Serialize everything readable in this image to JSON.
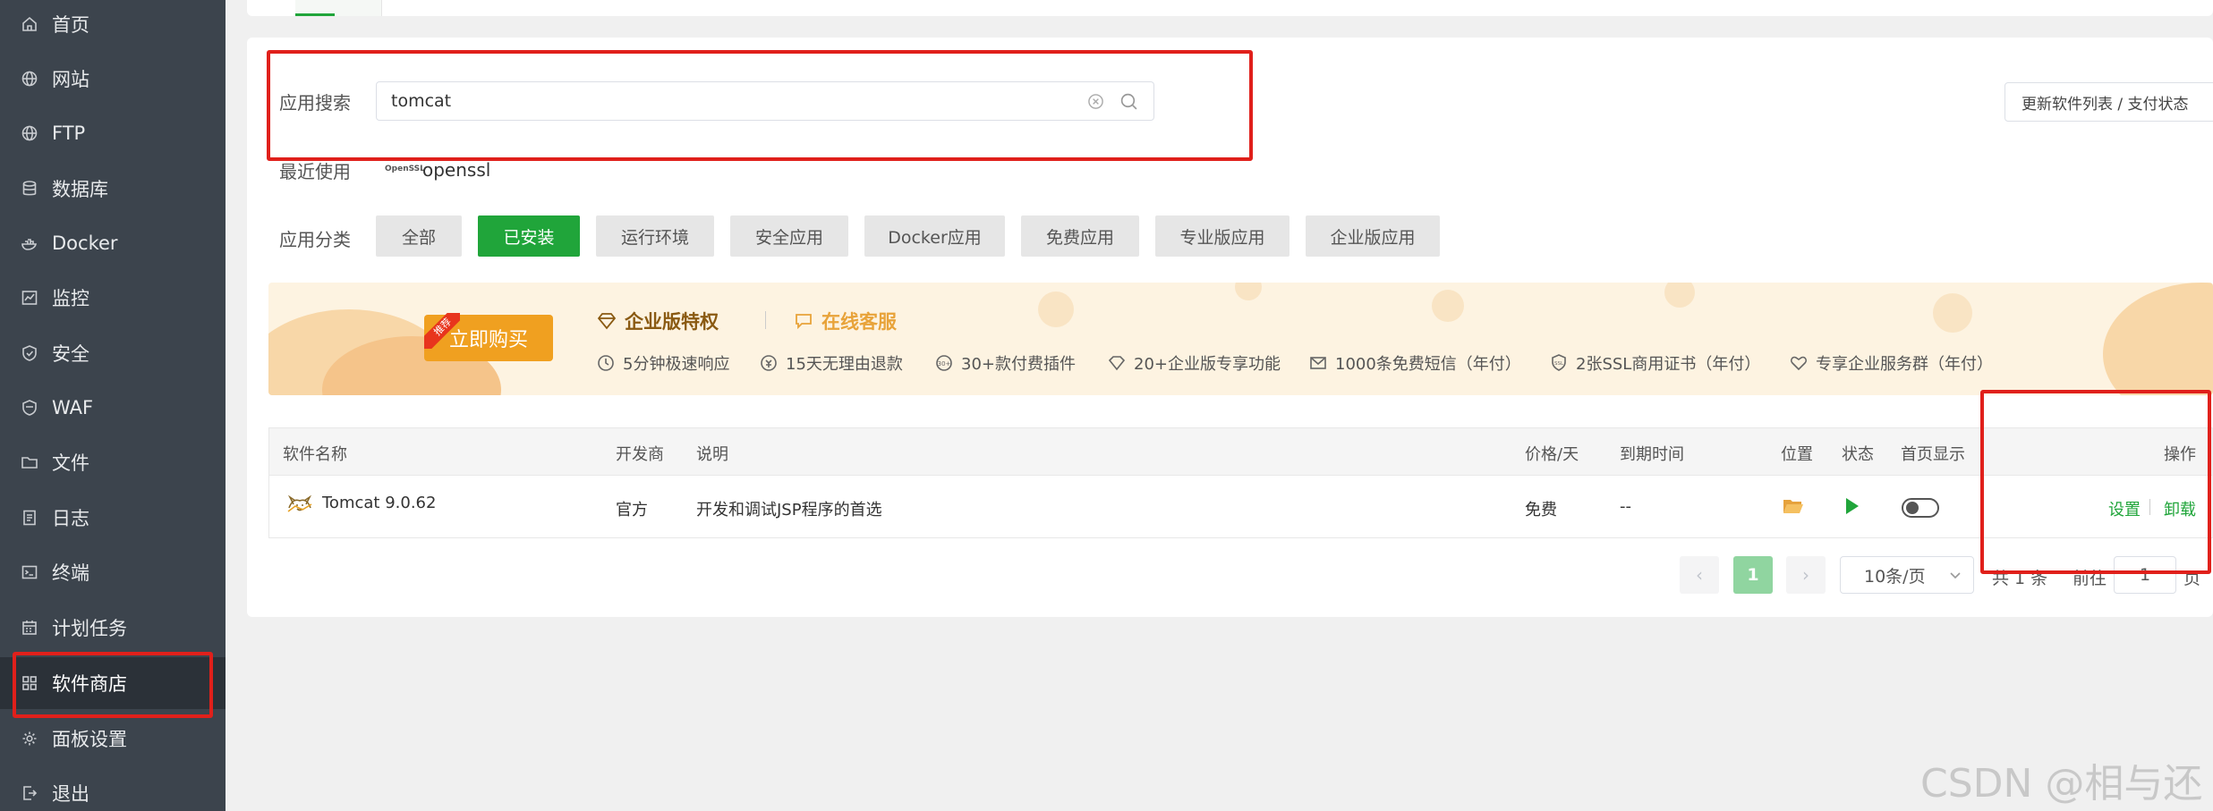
{
  "sidebar": {
    "items": [
      {
        "label": "首页",
        "icon": "home-icon"
      },
      {
        "label": "网站",
        "icon": "globe-icon"
      },
      {
        "label": "FTP",
        "icon": "globe-icon"
      },
      {
        "label": "数据库",
        "icon": "database-icon"
      },
      {
        "label": "Docker",
        "icon": "docker-icon"
      },
      {
        "label": "监控",
        "icon": "chart-icon"
      },
      {
        "label": "安全",
        "icon": "shield-icon"
      },
      {
        "label": "WAF",
        "icon": "waf-shield-icon"
      },
      {
        "label": "文件",
        "icon": "folder-icon"
      },
      {
        "label": "日志",
        "icon": "log-icon"
      },
      {
        "label": "终端",
        "icon": "terminal-icon"
      },
      {
        "label": "计划任务",
        "icon": "calendar-icon"
      },
      {
        "label": "软件商店",
        "icon": "grid-icon"
      },
      {
        "label": "面板设置",
        "icon": "gear-icon"
      },
      {
        "label": "退出",
        "icon": "logout-icon"
      }
    ],
    "active_index": 12
  },
  "search": {
    "label": "应用搜索",
    "value": "tomcat"
  },
  "refresh_button": "更新软件列表 / 支付状态",
  "recent": {
    "label": "最近使用",
    "logo_text": "OpenSSL",
    "item": "openssl"
  },
  "categories": {
    "label": "应用分类",
    "items": [
      "全部",
      "已安装",
      "运行环境",
      "安全应用",
      "Docker应用",
      "免费应用",
      "专业版应用",
      "企业版应用"
    ],
    "active_index": 1
  },
  "banner": {
    "ribbon": "推荐",
    "buy_button": "立即购买",
    "enterprise_title": "企业版特权",
    "service_title": "在线客服",
    "features": [
      "5分钟极速响应",
      "15天无理由退款",
      "30+款付费插件",
      "20+企业版专享功能",
      "1000条免费短信（年付）",
      "2张SSL商用证书（年付）",
      "专享企业服务群（年付）"
    ],
    "icon_30_text": "30+",
    "icon_ssl_text": "SSL",
    "colors": {
      "title": "#8a5a12",
      "service": "#e8a33a",
      "buy": "#f0a020"
    }
  },
  "table": {
    "headers": {
      "name": "软件名称",
      "developer": "开发商",
      "description": "说明",
      "price": "价格/天",
      "expire": "到期时间",
      "location": "位置",
      "status": "状态",
      "homepage": "首页显示",
      "actions": "操作"
    },
    "rows": [
      {
        "name": "Tomcat 9.0.62",
        "developer": "官方",
        "description": "开发和调试JSP程序的首选",
        "price": "免费",
        "expire": "--",
        "homepage_shown": false,
        "actions": [
          "设置",
          "卸载"
        ]
      }
    ]
  },
  "pagination": {
    "prev": "‹",
    "next": "›",
    "current": "1",
    "page_size": "10条/页",
    "total": "共 1 条",
    "goto": "前往",
    "goto_value": "1",
    "page_unit": "页"
  },
  "watermark": "CSDN @相与还",
  "colors": {
    "accent": "#20a53a",
    "sidebar": "#3c444d",
    "annotation": "#e0201b"
  }
}
